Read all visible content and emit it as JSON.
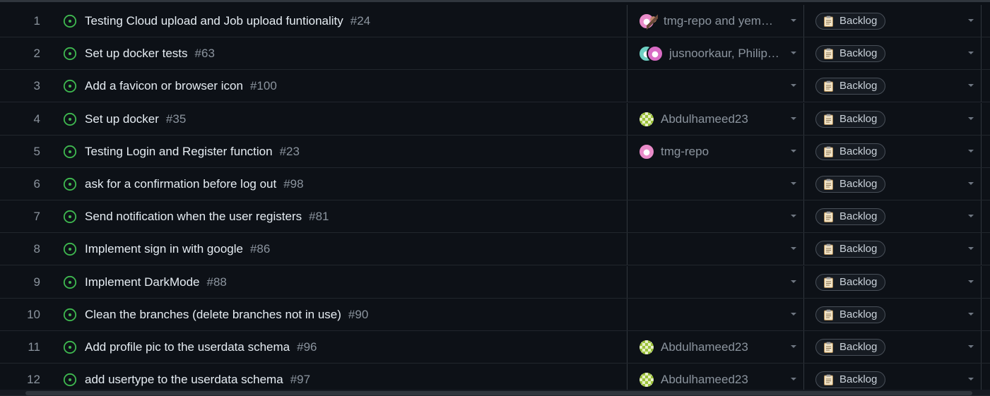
{
  "colors": {
    "background": "#0d1117",
    "open_issue_green": "#3fb950",
    "text_primary": "#e6edf3",
    "text_muted": "#8b949e",
    "border": "#30363d"
  },
  "rows": [
    {
      "num": "1",
      "title": "Testing Cloud upload and Job upload funtionality",
      "issue": "#24",
      "assignees": "tmg-repo and yem…",
      "avatars": [
        "pink",
        "bird"
      ],
      "status": "Backlog"
    },
    {
      "num": "2",
      "title": "Set up docker tests",
      "issue": "#63",
      "assignees": "jusnoorkaur, Philip…",
      "avatars": [
        "teal",
        "magenta"
      ],
      "status": "Backlog"
    },
    {
      "num": "3",
      "title": "Add a favicon or browser icon",
      "issue": "#100",
      "assignees": "",
      "avatars": [],
      "status": "Backlog"
    },
    {
      "num": "4",
      "title": "Set up docker",
      "issue": "#35",
      "assignees": "Abdulhameed23",
      "avatars": [
        "green"
      ],
      "status": "Backlog"
    },
    {
      "num": "5",
      "title": "Testing Login and Register function",
      "issue": "#23",
      "assignees": "tmg-repo",
      "avatars": [
        "pink"
      ],
      "status": "Backlog"
    },
    {
      "num": "6",
      "title": "ask for a confirmation before log out",
      "issue": "#98",
      "assignees": "",
      "avatars": [],
      "status": "Backlog"
    },
    {
      "num": "7",
      "title": "Send notification when the user registers",
      "issue": "#81",
      "assignees": "",
      "avatars": [],
      "status": "Backlog"
    },
    {
      "num": "8",
      "title": "Implement sign in with google",
      "issue": "#86",
      "assignees": "",
      "avatars": [],
      "status": "Backlog"
    },
    {
      "num": "9",
      "title": "Implement DarkMode",
      "issue": "#88",
      "assignees": "",
      "avatars": [],
      "status": "Backlog"
    },
    {
      "num": "10",
      "title": "Clean the branches (delete branches not in use)",
      "issue": "#90",
      "assignees": "",
      "avatars": [],
      "status": "Backlog"
    },
    {
      "num": "11",
      "title": "Add profile pic to the userdata schema",
      "issue": "#96",
      "assignees": "Abdulhameed23",
      "avatars": [
        "green"
      ],
      "status": "Backlog"
    },
    {
      "num": "12",
      "title": "add usertype to the userdata schema",
      "issue": "#97",
      "assignees": "Abdulhameed23",
      "avatars": [
        "green"
      ],
      "status": "Backlog"
    }
  ]
}
